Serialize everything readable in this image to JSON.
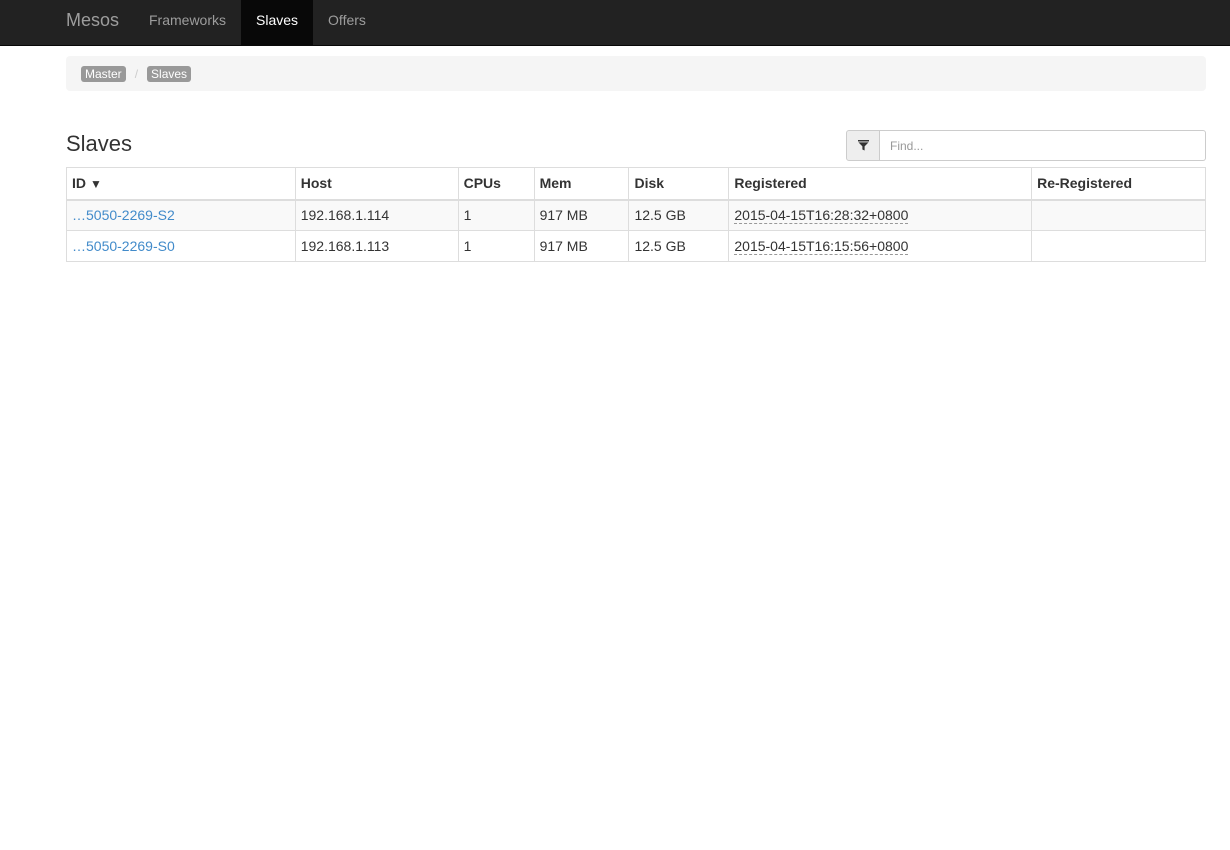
{
  "navbar": {
    "brand": "Mesos",
    "items": [
      {
        "label": "Frameworks",
        "active": false
      },
      {
        "label": "Slaves",
        "active": true
      },
      {
        "label": "Offers",
        "active": false
      }
    ]
  },
  "breadcrumb": {
    "items": [
      "Master",
      "Slaves"
    ],
    "separator": "/"
  },
  "page": {
    "title": "Slaves"
  },
  "search": {
    "placeholder": "Find..."
  },
  "table": {
    "columns": [
      "ID",
      "Host",
      "CPUs",
      "Mem",
      "Disk",
      "Registered",
      "Re-Registered"
    ],
    "sort_indicator": "▼",
    "rows": [
      {
        "id": "…5050-2269-S2",
        "host": "192.168.1.114",
        "cpus": "1",
        "mem": "917 MB",
        "disk": "12.5 GB",
        "registered": "2015-04-15T16:28:32+0800",
        "reregistered": ""
      },
      {
        "id": "…5050-2269-S0",
        "host": "192.168.1.113",
        "cpus": "1",
        "mem": "917 MB",
        "disk": "12.5 GB",
        "registered": "2015-04-15T16:15:56+0800",
        "reregistered": ""
      }
    ]
  },
  "colors": {
    "navbar_bg": "#222222",
    "link": "#428bca",
    "badge": "#999999"
  },
  "icons": {
    "filter": "filter-icon"
  }
}
